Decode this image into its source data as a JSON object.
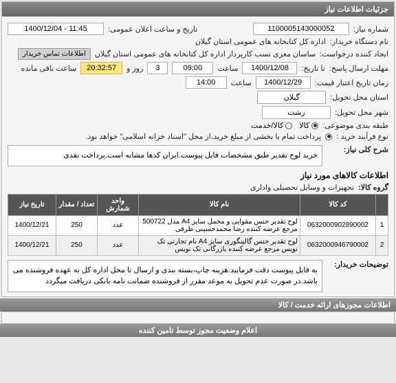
{
  "header": {
    "title": "جزئیات اطلاعات نیاز"
  },
  "info": {
    "needNumberLabel": "شماره نیاز:",
    "needNumber": "1100005143000052",
    "announceLabel": "تاریخ و ساعت اعلان عمومی:",
    "announceValue": "11:45 - 1400/12/04",
    "buyerOrgLabel": "نام دستگاه خریدار:",
    "buyerOrg": "اداره کل کتابخانه های عمومی استان گیلان",
    "requesterLabel": "ایجاد کننده درخواست:",
    "requester": "ساسان معزی نسب کارپرداز اداره کل کتابخانه های عمومی استان گیلان",
    "contactLink": "اطلاعات تماس خریدار",
    "deadlineLabel": "مهلت ارسال پاسخ:",
    "untilLabel": "تا تاریخ:",
    "deadlineDate": "1400/12/08",
    "timeLabel": "ساعت",
    "deadlineTime": "09:00",
    "dayCount": "3",
    "dayAnd": "روز و",
    "countdown": "20:32:57",
    "remainLabel": "ساعت باقی مانده",
    "validLabel": "زمان تاریخ اعتبار قیمت:",
    "validDate": "1400/12/29",
    "validTime": "14:00",
    "provinceLabel": "استان محل تحویل:",
    "province": "گیلان",
    "cityLabel": "شهر محل تحویل:",
    "city": "رشت",
    "categoryLabel": "طبقه بندی موضوعی:",
    "cat1": "کالا",
    "cat2": "کالا/خدمت",
    "processLabel": "نوع فرآیند خرید :",
    "processNote": "پرداخت تمام یا بخشی از مبلغ خرید،از محل \"اسناد خزانه اسلامی\" خواهد بود."
  },
  "desc": {
    "label": "شرح کلی نیاز:",
    "text": "خرید لوح تقدیر طبق مشخصات فایل پیوست.ایران کدها مشابه است.پرداخت نقدی"
  },
  "goods": {
    "sectionTitle": "اطلاعات کالاهای مورد نیاز",
    "groupLabel": "گروه کالا:",
    "groupValue": "تجهیزات و وسایل تحصیلی واداری",
    "columns": [
      "",
      "کد کالا",
      "نام کالا",
      "واحد شمارش",
      "تعداد / مقدار",
      "تاریخ نیاز"
    ],
    "rows": [
      {
        "n": "1",
        "code": "0632000902890002",
        "name": "لوح تقدیر جنس مقوایی و مخمل سایز A4 مدل 500722 مرجع عرضه کننده رضا محمدحسینی طرقی",
        "unit": "عدد",
        "qty": "250",
        "date": "1400/12/21"
      },
      {
        "n": "2",
        "code": "0632000946790002",
        "name": "لوح تقدیر جنس گالینگوری سایز A4 نام تجارتی تک نویس مرجع عرضه کننده بازرگانی تک نویس",
        "unit": "عدد",
        "qty": "250",
        "date": "1400/12/21"
      }
    ],
    "buyerNoteLabel": "توضیحات خریدار:",
    "buyerNote": "به فایل پیوست دقت فرمایید.هزینه چاپ،بسته بندی و ارسال تا محل اداره کل به عهده فروشنده می باشد.در صورت عدم تحویل به موعد مقرر از فروشنده ضمانت نامه بانکی دریافت میگردد"
  },
  "footer1": {
    "title": "اطلاعات مجوزهای ارائه خدمت / کالا"
  },
  "footer2": {
    "title": "اعلام وضعیت مجوز توسط تامین کننده"
  }
}
